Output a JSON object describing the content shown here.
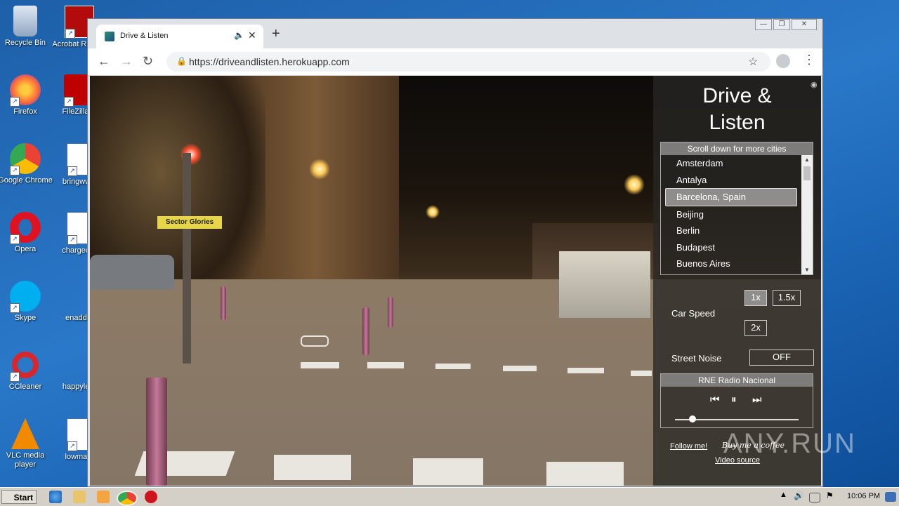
{
  "desktop": {
    "icons": [
      {
        "label": "Recycle Bin"
      },
      {
        "label": "Acrobat Reader"
      },
      {
        "label": "Firefox"
      },
      {
        "label": "FileZilla C"
      },
      {
        "label": "Google Chrome"
      },
      {
        "label": "bringwww"
      },
      {
        "label": "Opera"
      },
      {
        "label": "chargecivi"
      },
      {
        "label": "Skype"
      },
      {
        "label": "enadd.p"
      },
      {
        "label": "CCleaner"
      },
      {
        "label": "happylear"
      },
      {
        "label": "VLC media player"
      },
      {
        "label": "lowmatu"
      }
    ]
  },
  "browser": {
    "tab_title": "Drive & Listen",
    "url": "https://driveandlisten.herokuapp.com",
    "window_controls": [
      "—",
      "❐",
      "✕"
    ]
  },
  "app": {
    "title_line1": "Drive &",
    "title_line2": "Listen",
    "city_header": "Scroll down for more cities",
    "cities": [
      "Amsterdam",
      "Antalya",
      "Barcelona, Spain",
      "Beijing",
      "Berlin",
      "Budapest",
      "Buenos Aires"
    ],
    "selected_city": "Barcelona, Spain",
    "car_speed_label": "Car Speed",
    "speed_options": [
      "1x",
      "1.5x",
      "2x"
    ],
    "selected_speed": "1x",
    "street_noise_label": "Street Noise",
    "street_noise_value": "OFF",
    "radio_station": "RNE Radio Nacional",
    "volume_level": 0.14,
    "follow_link": "Follow me!",
    "coffee_link": "Buy me a coffee",
    "video_source_link": "Video source"
  },
  "street_signs": {
    "sign1": "Sector Glories"
  },
  "taskbar": {
    "start_label": "Start",
    "clock": "10:06 PM"
  },
  "watermark": "ANY.RUN"
}
